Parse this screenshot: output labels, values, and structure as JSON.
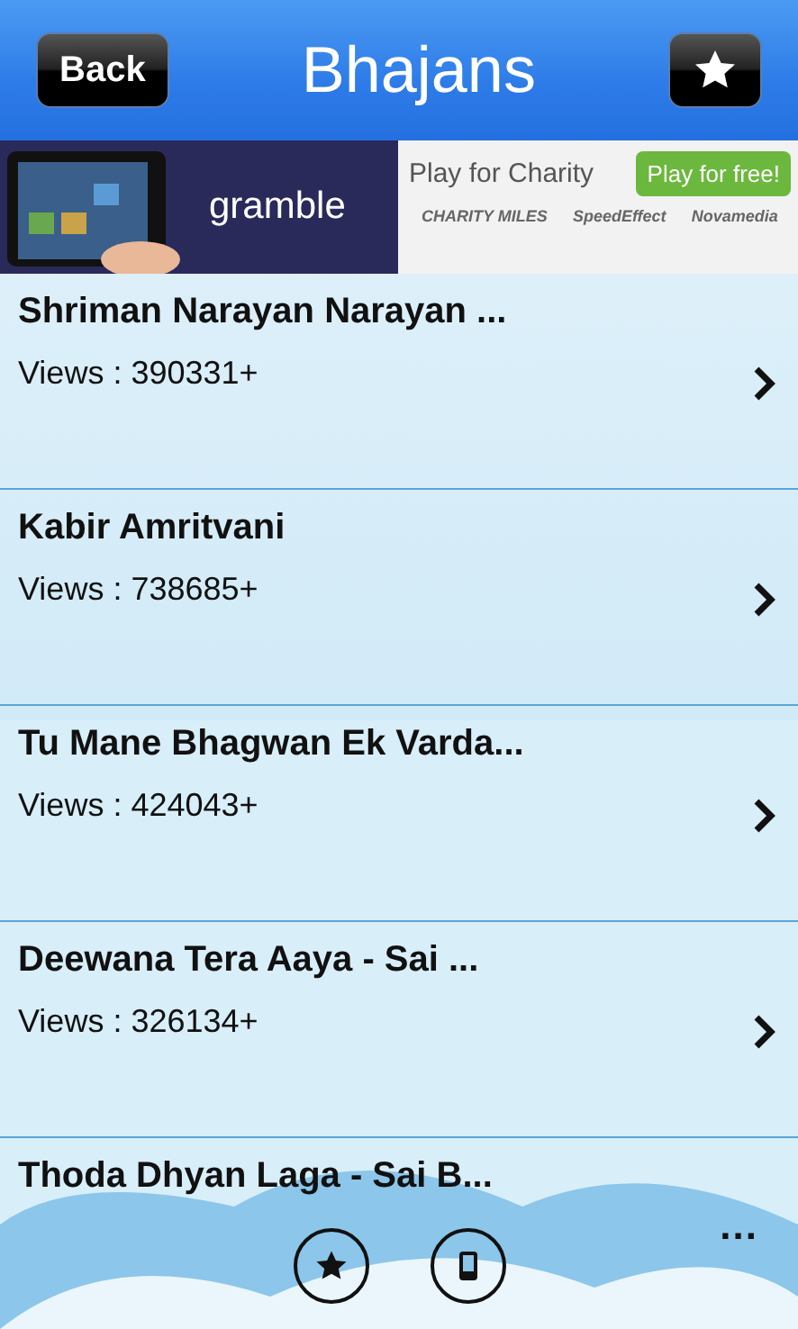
{
  "header": {
    "back": "Back",
    "title": "Bhajans"
  },
  "ad": {
    "brand": "gramble",
    "headline": "Play for Charity",
    "cta": "Play for free!",
    "sponsors": [
      "CHARITY MILES",
      "SpeedEffect",
      "Novamedia"
    ]
  },
  "items": [
    {
      "title": "Shriman Narayan Narayan ...",
      "views": "Views : 390331+"
    },
    {
      "title": "Kabir Amritvani",
      "views": "Views : 738685+"
    },
    {
      "title": "Tu Mane Bhagwan Ek Varda...",
      "views": "Views : 424043+"
    },
    {
      "title": "Deewana Tera Aaya - Sai ...",
      "views": "Views : 326134+"
    },
    {
      "title": "Thoda Dhyan Laga - Sai B..."
    }
  ],
  "app_bar": {
    "more": "..."
  }
}
